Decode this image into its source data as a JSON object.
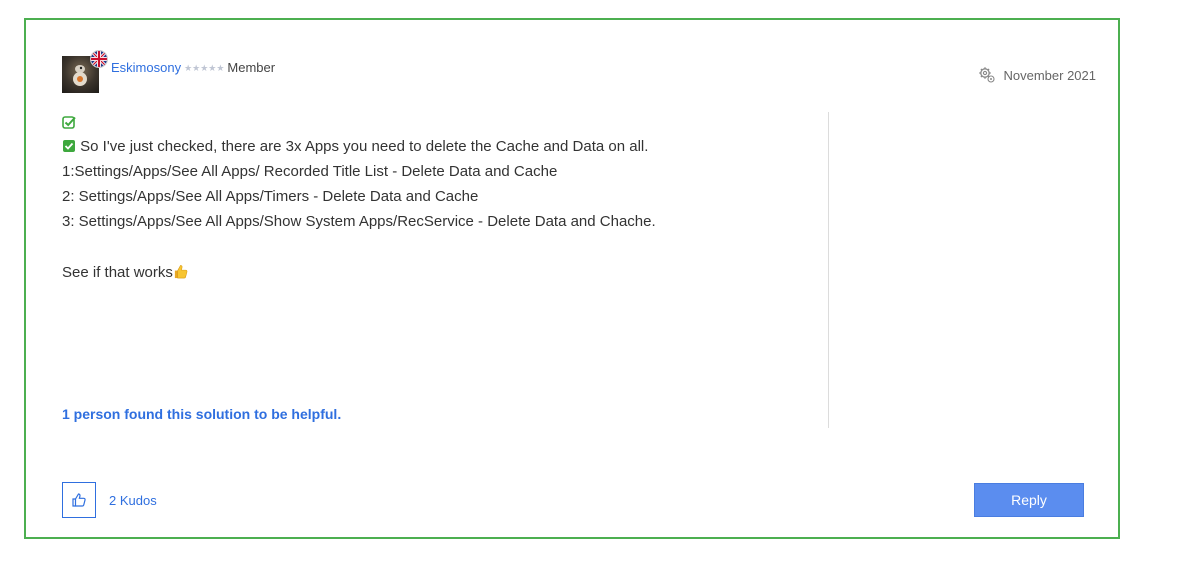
{
  "author": {
    "name": "Eskimosony",
    "stars": "★★★★★",
    "rank": "Member",
    "avatar_icon": "bb8-avatar-icon",
    "flag_icon": "uk-flag-icon"
  },
  "post": {
    "date": "November 2021",
    "date_icon": "gear-icon",
    "lines": [
      "So I've just checked, there are 3x Apps you need to delete the Cache and Data on all.",
      "1:Settings/Apps/See All Apps/ Recorded Title List - Delete Data and Cache",
      "2: Settings/Apps/See All Apps/Timers - Delete Data and Cache",
      "3: Settings/Apps/See All Apps/Show System Apps/RecService - Delete Data and Chache."
    ],
    "closing": "See if that works",
    "closing_emoji": "thumbs-up-icon"
  },
  "solution": {
    "helpful_text": "1 person found this solution to be helpful."
  },
  "actions": {
    "kudos_label": "2 Kudos",
    "reply_label": "Reply"
  },
  "colors": {
    "accent_blue": "#2f6fdf",
    "border_green": "#4caf50",
    "check_green": "#3ea83e",
    "reply_bg": "#5b8def"
  }
}
